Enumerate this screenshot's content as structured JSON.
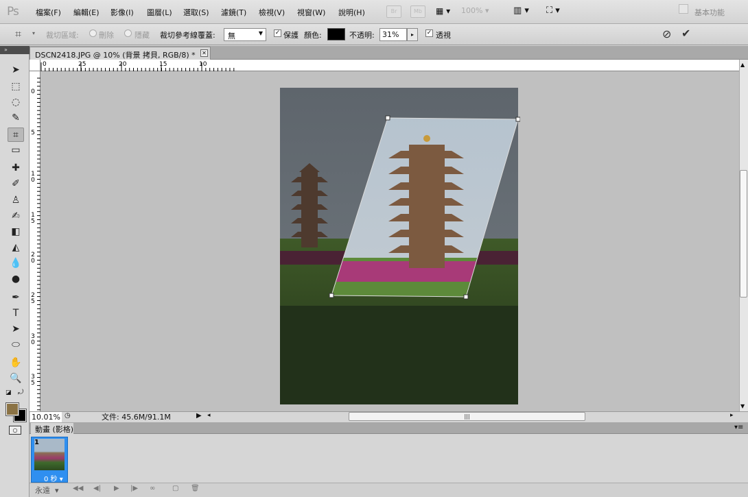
{
  "app": {
    "logo": "Ps",
    "workspace": "基本功能"
  },
  "menu": [
    "檔案(F)",
    "編輯(E)",
    "影像(I)",
    "圖層(L)",
    "選取(S)",
    "濾鏡(T)",
    "檢視(V)",
    "視窗(W)",
    "說明(H)"
  ],
  "appbar": {
    "bridge": "Br",
    "mini_bridge": "Mb",
    "zoom": "100%"
  },
  "options": {
    "crop_area_label": "裁切區域:",
    "delete_label": "刪除",
    "hide_label": "隱藏",
    "overlay_label": "裁切參考線覆蓋:",
    "overlay_value": "無",
    "shield_label": "保護",
    "color_label": "顏色:",
    "opacity_label": "不透明:",
    "opacity_value": "31%",
    "perspective_label": "透視",
    "cancel_icon": "cancel-icon",
    "commit_icon": "commit-check-icon"
  },
  "document": {
    "tab_title": "DSCN2418.JPG @ 10% (背景 拷貝, RGB/8) *",
    "ruler_h": [
      "0",
      "25",
      "20",
      "15",
      "10"
    ],
    "ruler_v": [
      "0",
      "5",
      "1 0",
      "1 5",
      "2 0",
      "2 5",
      "3 0",
      "3 5"
    ]
  },
  "status": {
    "zoom": "10.01%",
    "doc_info": "文件: 45.6M/91.1M"
  },
  "animation": {
    "tab": "動畫 (影格)",
    "frame_number": "1",
    "frame_delay": "0 秒",
    "loop": "永遠"
  },
  "tools": [
    "move-tool-icon",
    "marquee-tool-icon",
    "lasso-tool-icon",
    "quick-select-tool-icon",
    "crop-tool-icon",
    "ruler-tool-icon",
    "healing-brush-icon",
    "brush-tool-icon",
    "clone-stamp-icon",
    "history-brush-icon",
    "eraser-tool-icon",
    "paint-bucket-icon",
    "blur-tool-icon",
    "dodge-tool-icon",
    "pen-tool-icon",
    "type-tool-icon",
    "path-select-icon",
    "ellipse-shape-icon",
    "hand-tool-icon",
    "zoom-tool-icon"
  ],
  "colors": {
    "foreground": "#8b7345",
    "background": "#000000",
    "accent": "#2f8ff0"
  }
}
